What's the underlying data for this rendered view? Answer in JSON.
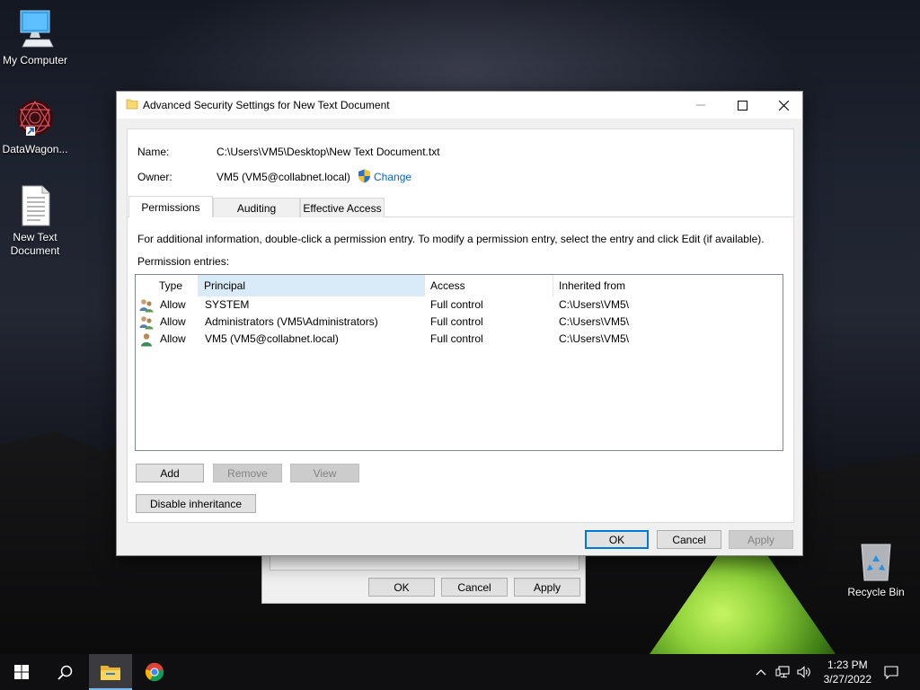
{
  "desktop": {
    "icons": [
      {
        "label": "My Computer"
      },
      {
        "label": "DataWagon..."
      },
      {
        "label": "New Text Document"
      },
      {
        "label": "Recycle Bin"
      }
    ]
  },
  "background_dialog": {
    "ok_label": "OK",
    "cancel_label": "Cancel",
    "apply_label": "Apply"
  },
  "dialog": {
    "title": "Advanced Security Settings for New Text Document",
    "name_label": "Name:",
    "name_value": "C:\\Users\\VM5\\Desktop\\New Text Document.txt",
    "owner_label": "Owner:",
    "owner_value": "VM5 (VM5@collabnet.local)",
    "change_link": "Change",
    "tabs": [
      {
        "label": "Permissions",
        "active": true
      },
      {
        "label": "Auditing",
        "active": false
      },
      {
        "label": "Effective Access",
        "active": false
      }
    ],
    "info_text": "For additional information, double-click a permission entry. To modify a permission entry, select the entry and click Edit (if available).",
    "entries_label": "Permission entries:",
    "columns": [
      "Type",
      "Principal",
      "Access",
      "Inherited from"
    ],
    "rows": [
      {
        "icon": "group-users-icon",
        "type": "Allow",
        "principal": "SYSTEM",
        "access": "Full control",
        "inherited": "C:\\Users\\VM5\\"
      },
      {
        "icon": "group-users-icon",
        "type": "Allow",
        "principal": "Administrators (VM5\\Administrators)",
        "access": "Full control",
        "inherited": "C:\\Users\\VM5\\"
      },
      {
        "icon": "user-icon",
        "type": "Allow",
        "principal": "VM5 (VM5@collabnet.local)",
        "access": "Full control",
        "inherited": "C:\\Users\\VM5\\"
      }
    ],
    "add_label": "Add",
    "remove_label": "Remove",
    "view_label": "View",
    "disable_inheritance_label": "Disable inheritance",
    "ok_label": "OK",
    "cancel_label": "Cancel",
    "apply_label": "Apply"
  },
  "taskbar": {
    "time": "1:23 PM",
    "date": "3/27/2022"
  },
  "colors": {
    "accent": "#0078d7",
    "link": "#0066cc",
    "sorted_column": "#d9ebf9"
  }
}
